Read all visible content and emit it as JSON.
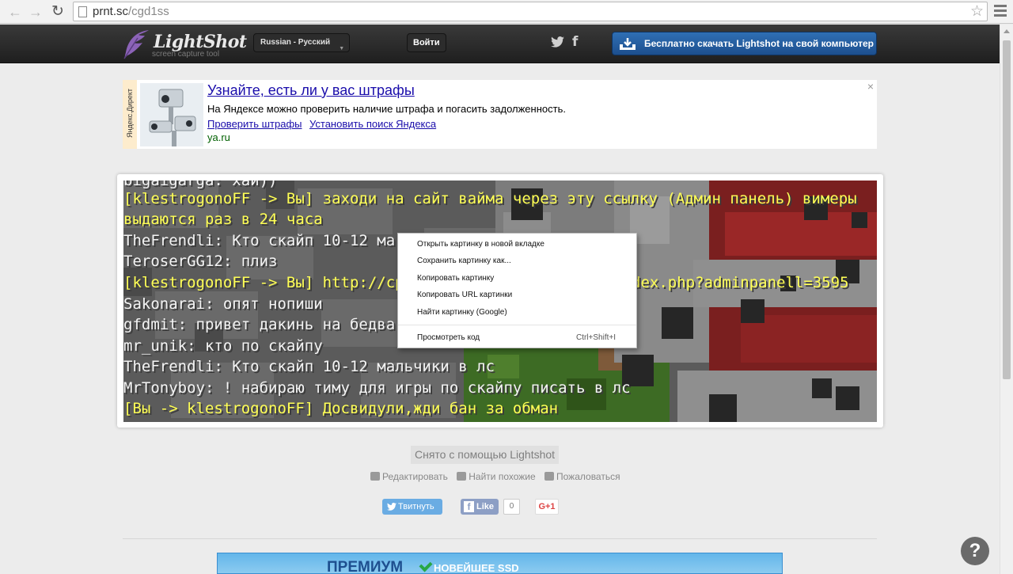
{
  "browser": {
    "url_host": "prnt.sc",
    "url_path": "/cgd1ss"
  },
  "header": {
    "brand": "LightShot",
    "tagline": "screen capture tool",
    "language": "Russian - Русский",
    "login": "Войти",
    "facebook_glyph": "f",
    "download": "Бесплатно скачать Lightshot на свой компьютер"
  },
  "ad": {
    "tag": "Яндекс.Директ",
    "title": "Узнайте, есть ли у вас штрафы",
    "text": "На Яндексе можно проверить наличие штрафа и погасить задолженность.",
    "link1": "Проверить штрафы",
    "link2": "Установить поиск Яндекса",
    "domain": "ya.ru",
    "close": "×"
  },
  "screenshot": {
    "chat": [
      {
        "prefix": "bigaigarga: хай",
        "rest": "))"
      },
      {
        "prefix": "[klestrogonoFF -> Вы] ",
        "rest": "заходи на сайт вайма через эту ссылку (Админ панель) вимеры"
      },
      {
        "prefix": "",
        "rest": " выдаются раз в 24 часа"
      },
      {
        "prefix": "TheFrendli: ",
        "rest": "Кто скайп 10-12 ма"
      },
      {
        "prefix": "TeroserGG12: ",
        "rest": "плиз"
      },
      {
        "prefix": "[klestrogonoFF -> Вы] ",
        "rest": "http://cp."
      },
      {
        "prefix": "",
        "rest": "dex.php?adminpanell=3595"
      },
      {
        "prefix": "Sakonarai: ",
        "rest": "опят нопиши"
      },
      {
        "prefix": "gfdmit: ",
        "rest": "привет дакинь на бедва"
      },
      {
        "prefix": "mr_unik: ",
        "rest": "кто по скайпу"
      },
      {
        "prefix": "TheFrendli: ",
        "rest": "Кто скайп 10-12 мальчики в лс"
      },
      {
        "prefix": "MrTonyboy: ",
        "rest": "! набираю тиму для игры по скайпу писать в лс"
      },
      {
        "prefix": "[Вы -> klestrogonoFF] ",
        "rest": "Досвидули,жди бан за обман"
      }
    ]
  },
  "context_menu": {
    "items": [
      "Открыть картинку в новой вкладке",
      "Сохранить картинку как...",
      "Копировать картинку",
      "Копировать URL картинки",
      "Найти картинку (Google)",
      "Просмотреть код"
    ],
    "shortcut": "Ctrl+Shift+I"
  },
  "footer": {
    "credit": "Снято с помощью Lightshot",
    "edit": "Редактировать",
    "similar": "Найти похожие",
    "report": "Пожаловаться",
    "tweet": "Твитнуть",
    "like": "Like",
    "like_count": "0",
    "gplus": "G+1",
    "banner_big": "ПРЕМИУМ",
    "banner_small": "НОВЕЙШЕЕ SSD",
    "help": "?"
  }
}
